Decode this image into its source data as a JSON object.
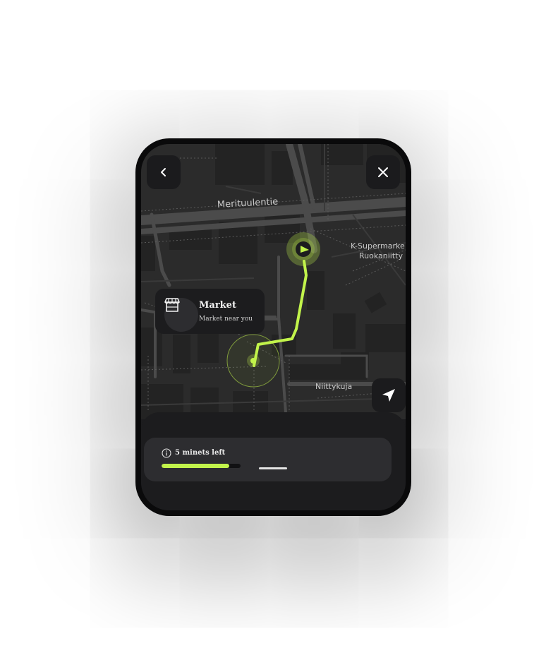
{
  "colors": {
    "accent": "#c2f44b",
    "surface": "#1c1c1e",
    "card": "#2d2d30",
    "map_bg": "#2b2b2b"
  },
  "header": {
    "back_icon": "chevron-left-icon",
    "close_icon": "close-icon"
  },
  "map": {
    "streets": [
      "Merituulentie",
      "Niittykuja"
    ],
    "poi": {
      "line1": "K-Supermarke",
      "line2": "Ruokaniitty"
    }
  },
  "place_card": {
    "icon": "storefront-icon",
    "title": "Market",
    "subtitle": "Market  near you"
  },
  "navigate_button": {
    "icon": "navigation-arrow-icon"
  },
  "trip": {
    "info_icon": "info-icon",
    "time_left": "5 minets left",
    "progress": 0.86
  }
}
